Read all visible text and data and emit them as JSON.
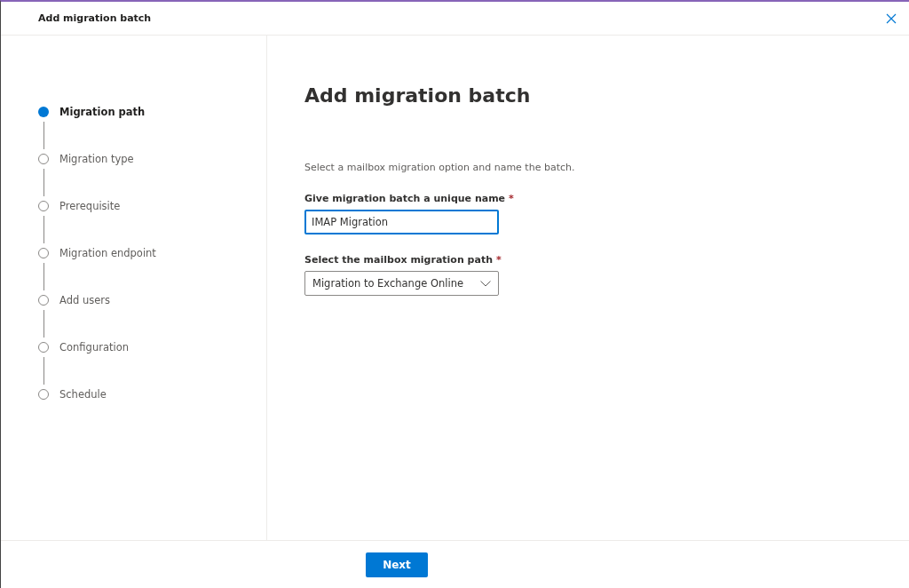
{
  "window": {
    "title": "Add migration batch"
  },
  "steps": [
    {
      "label": "Migration path",
      "selected": true
    },
    {
      "label": "Migration type",
      "selected": false
    },
    {
      "label": "Prerequisite",
      "selected": false
    },
    {
      "label": "Migration endpoint",
      "selected": false
    },
    {
      "label": "Add users",
      "selected": false
    },
    {
      "label": "Configuration",
      "selected": false
    },
    {
      "label": "Schedule",
      "selected": false
    }
  ],
  "content": {
    "heading": "Add migration batch",
    "description": "Select a mailbox migration option and name the batch.",
    "name_field": {
      "label": "Give migration batch a unique name",
      "required": "*",
      "value": "IMAP Migration"
    },
    "path_field": {
      "label": "Select the mailbox migration path",
      "required": "*",
      "value": "Migration to Exchange Online"
    }
  },
  "footer": {
    "button": "Next"
  }
}
